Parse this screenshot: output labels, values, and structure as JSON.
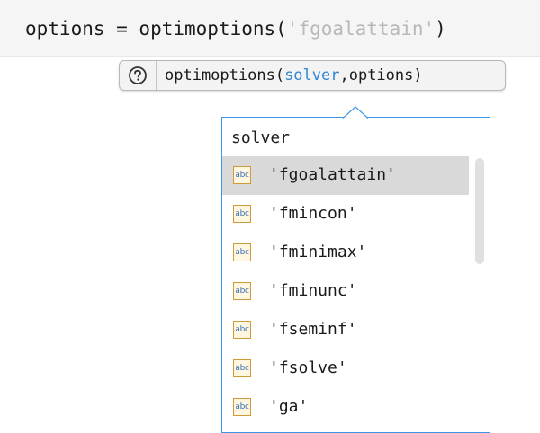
{
  "editor": {
    "code_prefix": "options = optimoptions(",
    "code_string": "'fgoalattain'",
    "code_suffix": ")"
  },
  "tooltip": {
    "help_icon": "question-circle-icon",
    "sig_prefix": "optimoptions(",
    "sig_active": "solver",
    "sig_rest": ",options)",
    "active_color": "#2f86d6"
  },
  "completion": {
    "header": "solver",
    "border_color": "#3b96e5",
    "selected_index": 0,
    "items": [
      {
        "label": "'fgoalattain'",
        "icon": "abc-string-icon",
        "icon_text": "abc"
      },
      {
        "label": "'fmincon'",
        "icon": "abc-string-icon",
        "icon_text": "abc"
      },
      {
        "label": "'fminimax'",
        "icon": "abc-string-icon",
        "icon_text": "abc"
      },
      {
        "label": "'fminunc'",
        "icon": "abc-string-icon",
        "icon_text": "abc"
      },
      {
        "label": "'fseminf'",
        "icon": "abc-string-icon",
        "icon_text": "abc"
      },
      {
        "label": "'fsolve'",
        "icon": "abc-string-icon",
        "icon_text": "abc"
      },
      {
        "label": "'ga'",
        "icon": "abc-string-icon",
        "icon_text": "abc"
      }
    ]
  }
}
